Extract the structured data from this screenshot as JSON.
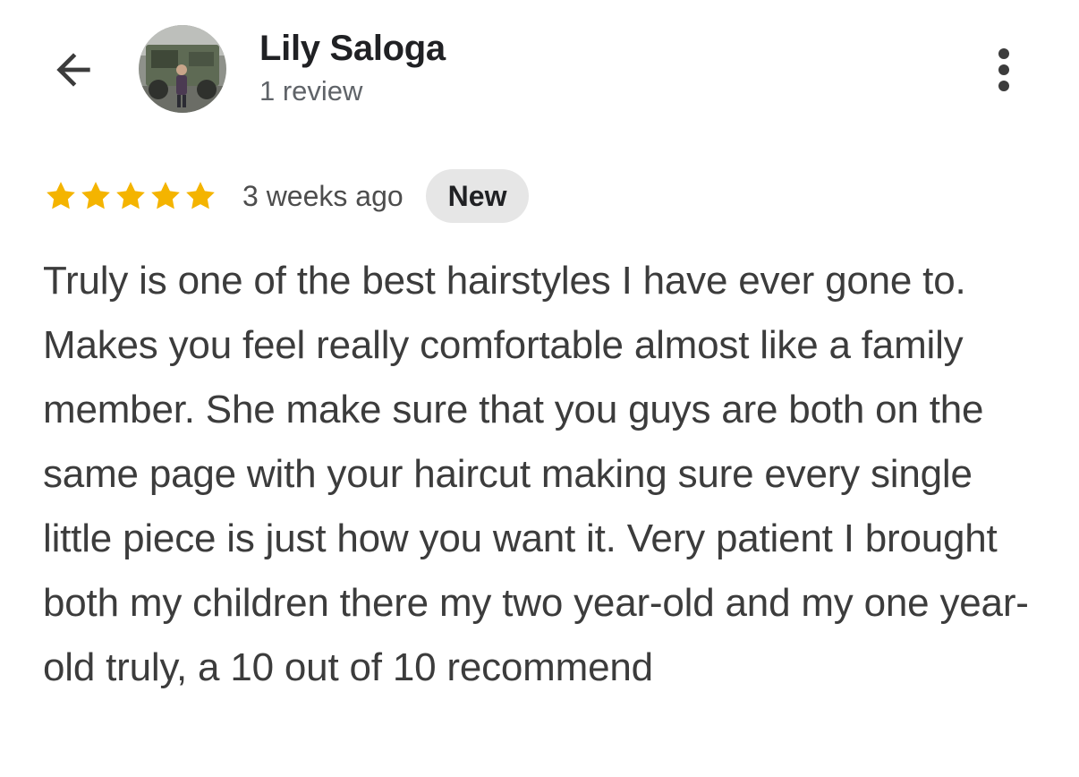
{
  "header": {
    "back_icon": "arrow-left-icon",
    "avatar_icon": "user-avatar-photo",
    "user_name": "Lily Saloga",
    "review_count": "1 review",
    "more_icon": "more-vertical-icon"
  },
  "review": {
    "rating": 5,
    "rating_max": 5,
    "star_color": "#f4b400",
    "time_ago": "3 weeks ago",
    "badge": "New",
    "text": "Truly is one of the best hairstyles I have ever gone to. Makes you feel really comfortable almost like a family member. She make sure that you guys are both on the same page with your haircut making sure every single little piece is just how you want it. Very patient I brought both my children there my two year-old and my one year-old truly, a 10 out of 10 recommend"
  }
}
